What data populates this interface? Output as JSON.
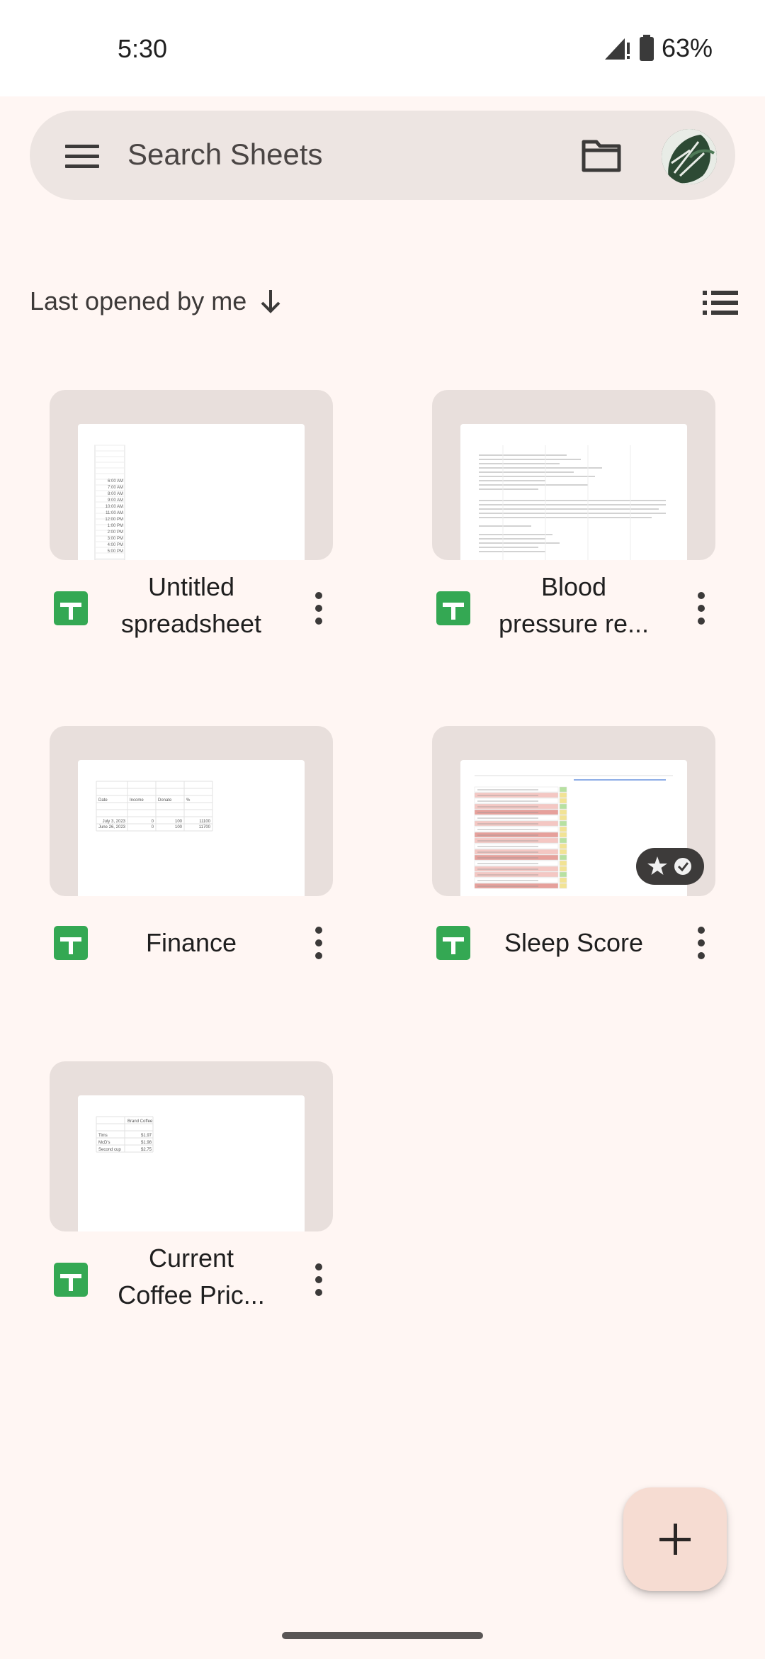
{
  "status_bar": {
    "time": "5:30",
    "battery": "63%"
  },
  "search": {
    "placeholder": "Search Sheets"
  },
  "sort": {
    "label": "Last opened by me"
  },
  "files": [
    {
      "title_line1": "Untitled",
      "title_line2": "spreadsheet",
      "starred_offline": false
    },
    {
      "title_line1": "Blood",
      "title_line2": "pressure re...",
      "starred_offline": false
    },
    {
      "title_line1": "Finance",
      "title_line2": "",
      "starred_offline": false
    },
    {
      "title_line1": "Sleep Score",
      "title_line2": "",
      "starred_offline": true
    },
    {
      "title_line1": "Current",
      "title_line2": "Coffee Pric...",
      "starred_offline": false
    }
  ],
  "thumbnails": {
    "untitled_times": [
      "6:00 AM",
      "7:00 AM",
      "8:00 AM",
      "9:00 AM",
      "10:00 AM",
      "11:00 AM",
      "12:00 PM",
      "1:00 PM",
      "2:00 PM",
      "3:00 PM",
      "4:00 PM",
      "5:00 PM"
    ],
    "finance_headers": [
      "Date",
      "Income",
      "Donate",
      "%"
    ],
    "finance_rows": [
      [
        "July 3, 2023",
        "0",
        "100",
        "11100"
      ],
      [
        "June 26, 2023",
        "0",
        "100",
        "11700"
      ]
    ],
    "coffee_header": "Brand Coffee",
    "coffee_rows": [
      [
        "Tims",
        "$1.97"
      ],
      [
        "McD's",
        "$1.98"
      ],
      [
        "Second cup",
        "$2.75"
      ]
    ]
  },
  "colors": {
    "background": "#fff6f3",
    "search_bar": "#ede5e2",
    "sheets_green": "#34a853",
    "fab": "#f6dcd2"
  }
}
